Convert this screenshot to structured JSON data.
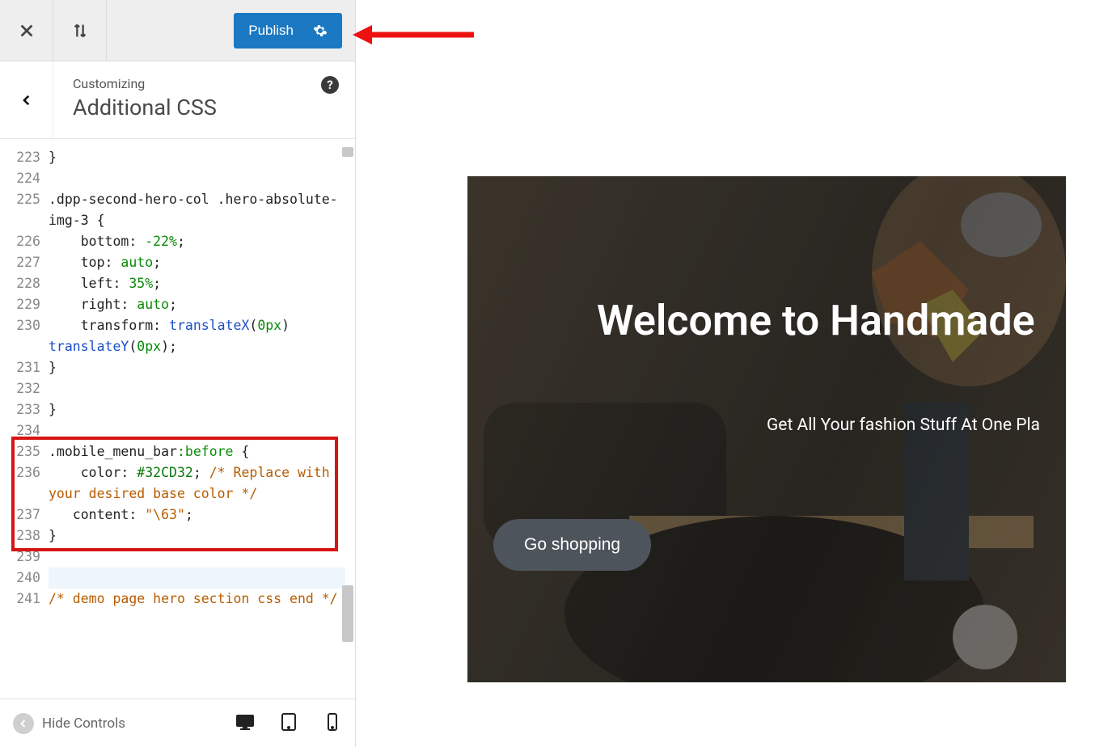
{
  "topbar": {
    "close_label": "Close",
    "reorder_label": "Reorder",
    "publish_label": "Publish",
    "settings_label": "Settings"
  },
  "panel": {
    "eyebrow": "Customizing",
    "title": "Additional CSS",
    "help_label": "?"
  },
  "editor": {
    "first_line": 223,
    "lines": [
      {
        "n": 223,
        "segs": [
          {
            "t": "}",
            "c": ""
          }
        ]
      },
      {
        "n": 224,
        "segs": []
      },
      {
        "n": 225,
        "segs": [
          {
            "t": ".dpp-second-hero-col .hero-absolute-img-3 {",
            "c": "tok-sel"
          }
        ]
      },
      {
        "n": 226,
        "segs": [
          {
            "t": "    bottom: ",
            "c": ""
          },
          {
            "t": "-22%",
            "c": "tok-num"
          },
          {
            "t": ";",
            "c": ""
          }
        ]
      },
      {
        "n": 227,
        "segs": [
          {
            "t": "    top: ",
            "c": ""
          },
          {
            "t": "auto",
            "c": "tok-num"
          },
          {
            "t": ";",
            "c": ""
          }
        ]
      },
      {
        "n": 228,
        "segs": [
          {
            "t": "    left: ",
            "c": ""
          },
          {
            "t": "35%",
            "c": "tok-num"
          },
          {
            "t": ";",
            "c": ""
          }
        ]
      },
      {
        "n": 229,
        "segs": [
          {
            "t": "    right: ",
            "c": ""
          },
          {
            "t": "auto",
            "c": "tok-num"
          },
          {
            "t": ";",
            "c": ""
          }
        ]
      },
      {
        "n": 230,
        "segs": [
          {
            "t": "    transform: ",
            "c": ""
          },
          {
            "t": "translateX",
            "c": "tok-fn"
          },
          {
            "t": "(",
            "c": ""
          },
          {
            "t": "0px",
            "c": "tok-num"
          },
          {
            "t": ") ",
            "c": ""
          },
          {
            "t": "translateY",
            "c": "tok-fn"
          },
          {
            "t": "(",
            "c": ""
          },
          {
            "t": "0px",
            "c": "tok-num"
          },
          {
            "t": ");",
            "c": ""
          }
        ]
      },
      {
        "n": 231,
        "segs": [
          {
            "t": "}",
            "c": ""
          }
        ]
      },
      {
        "n": 232,
        "segs": []
      },
      {
        "n": 233,
        "segs": [
          {
            "t": "}",
            "c": ""
          }
        ]
      },
      {
        "n": 234,
        "segs": []
      },
      {
        "n": 235,
        "segs": [
          {
            "t": ".mobile_menu_bar",
            "c": "tok-sel"
          },
          {
            "t": ":before",
            "c": "tok-pseudo"
          },
          {
            "t": " {",
            "c": ""
          }
        ],
        "boxed": true
      },
      {
        "n": 236,
        "segs": [
          {
            "t": "    color: ",
            "c": ""
          },
          {
            "t": "#32CD32",
            "c": "tok-hex"
          },
          {
            "t": "; ",
            "c": ""
          },
          {
            "t": "/* Replace with your desired base color */",
            "c": "tok-comment"
          }
        ],
        "boxed": true
      },
      {
        "n": 237,
        "segs": [
          {
            "t": "   content: ",
            "c": ""
          },
          {
            "t": "\"\\63\"",
            "c": "tok-str"
          },
          {
            "t": ";",
            "c": ""
          }
        ],
        "boxed": true
      },
      {
        "n": 238,
        "segs": [
          {
            "t": "}",
            "c": ""
          }
        ],
        "boxed": true
      },
      {
        "n": 239,
        "segs": []
      },
      {
        "n": 240,
        "segs": [],
        "cursor": true
      },
      {
        "n": 241,
        "segs": [
          {
            "t": "/* demo page hero section css end */",
            "c": "tok-comment"
          }
        ]
      }
    ]
  },
  "footer": {
    "hide_label": "Hide Controls",
    "devices": {
      "desktop": "Desktop",
      "tablet": "Tablet",
      "mobile": "Mobile"
    }
  },
  "preview": {
    "hero_title": "Welcome to Handmade",
    "hero_subtitle": "Get All Your fashion Stuff At One Pla",
    "cta_label": "Go shopping"
  },
  "annotation": {
    "arrow_points_to": "publish-button"
  }
}
